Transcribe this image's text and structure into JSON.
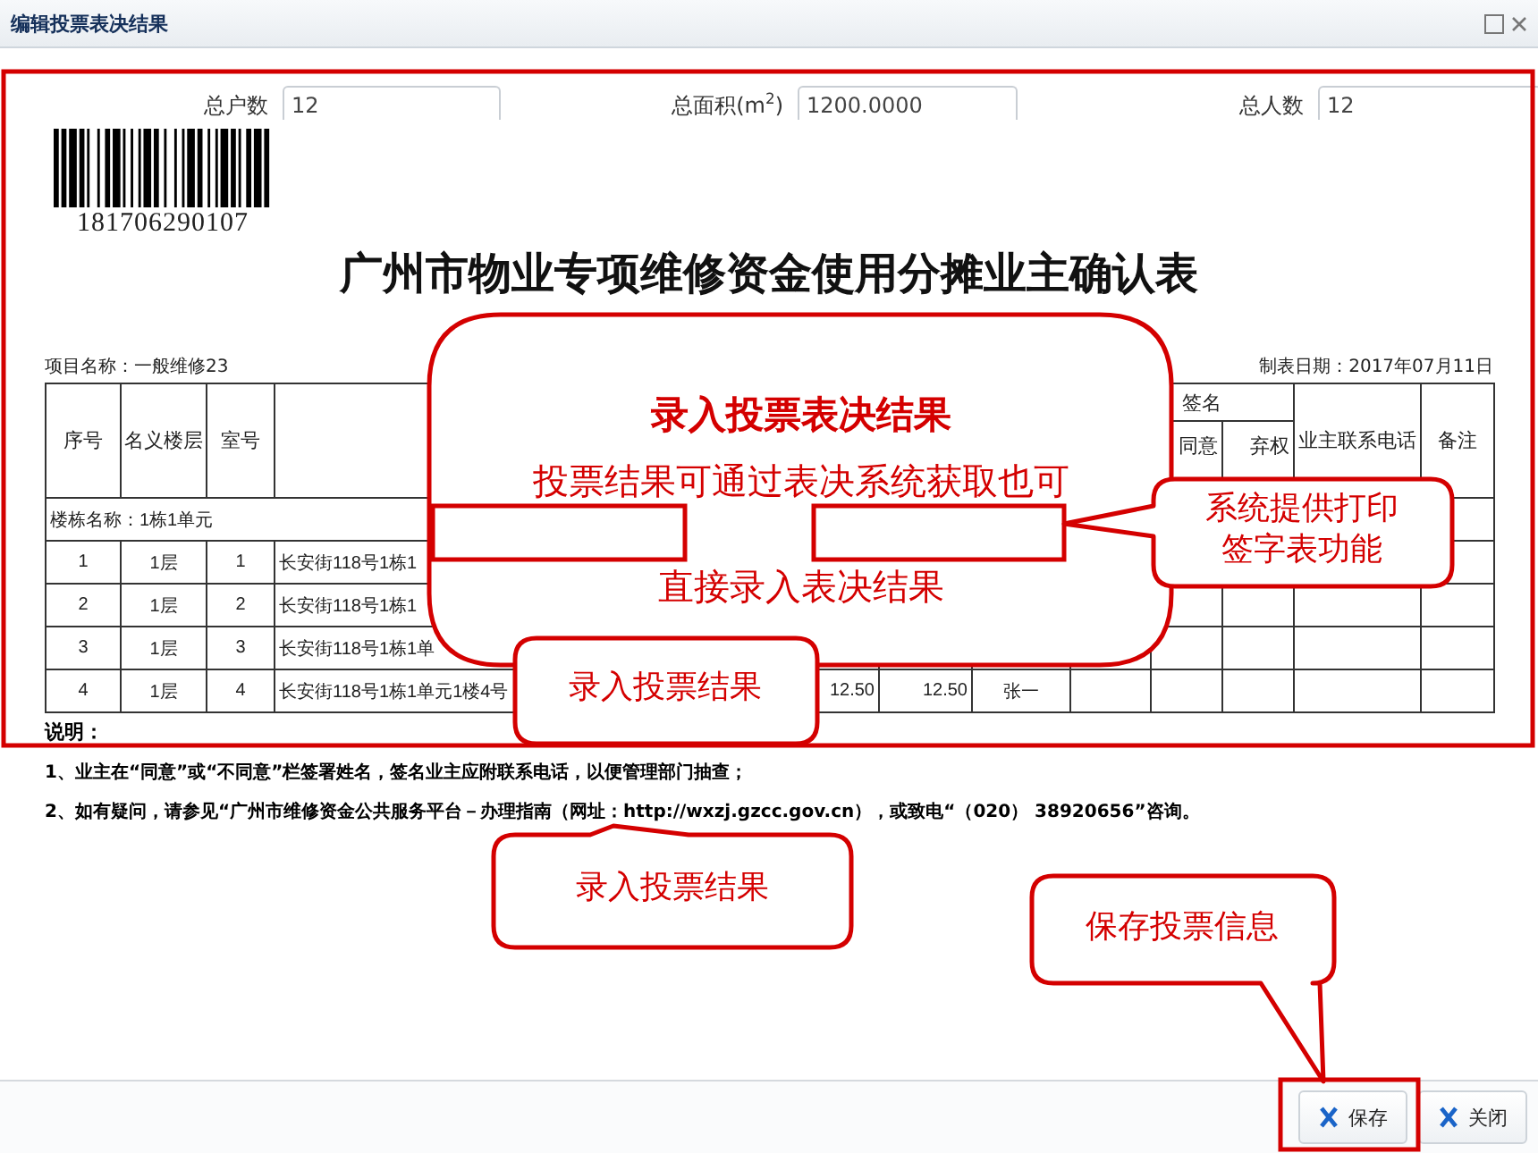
{
  "window": {
    "title": "编辑投票表决结果"
  },
  "summary_fields": [
    {
      "label": "总户数",
      "value": "12"
    },
    {
      "label": "总面积(m$^{2}$)",
      "value": "1200.0000"
    },
    {
      "label": "总人数",
      "value": "12"
    }
  ],
  "document": {
    "barcode_number": "181706290107",
    "heading": "广州市物业专项维修资金使用分摊业主确认表",
    "project": "项目名称：一般维修23",
    "date": "制表日期：2017年07月11日",
    "table": {
      "columns": [
        {
          "label": "序号"
        },
        {
          "label": "名义楼层"
        },
        {
          "label": "室号"
        }
      ],
      "group": {
        "label": "签名",
        "columns": [
          {
            "label": "同意"
          },
          {
            "label": "弃权"
          }
        ]
      },
      "trailing_columns": [
        {
          "label": "业主联系电话"
        },
        {
          "label": "备注"
        }
      ],
      "building_row": "楼栋名称：1栋1单元",
      "rows": [
        {
          "cells": [
            "1",
            "1层",
            "1",
            "长安街118号1栋1"
          ]
        },
        {
          "cells": [
            "2",
            "1层",
            "2",
            "长安街118号1栋1"
          ]
        },
        {
          "cells": [
            "3",
            "1层",
            "3",
            "长安街118号1栋1单"
          ]
        },
        {
          "cells": [
            "4",
            "1层",
            "4",
            "长安街118号1栋1单元1楼4号",
            null,
            null,
            "12.50",
            "12.50",
            "张一"
          ]
        }
      ]
    },
    "notes_title": "说明：",
    "notes": [
      "1、业主在“同意”或“不同意”栏签署姓名，签名业主应附联系电话，以便管理部门抽查；",
      "2、如有疑问，请参见“广州市维修资金公共服务平台－办理指南（网址：http://wxzj.gzcc.gov.cn），或致电“（020） 38920656”咨询。"
    ]
  },
  "callouts": [
    {
      "title": "录入投票表决结果",
      "lines": [
        "投票结果可通过表决系统获取也可",
        "直接录入表决结果"
      ]
    },
    {
      "lines": [
        "系统提供打印",
        "签字表功能"
      ]
    },
    {
      "lines": [
        "录入投票结果"
      ]
    },
    {
      "lines": [
        "录入投票结果"
      ]
    },
    {
      "lines": [
        "保存投票信息"
      ]
    }
  ],
  "buttons": [
    {
      "label": "保存"
    },
    {
      "label": "关闭"
    }
  ]
}
